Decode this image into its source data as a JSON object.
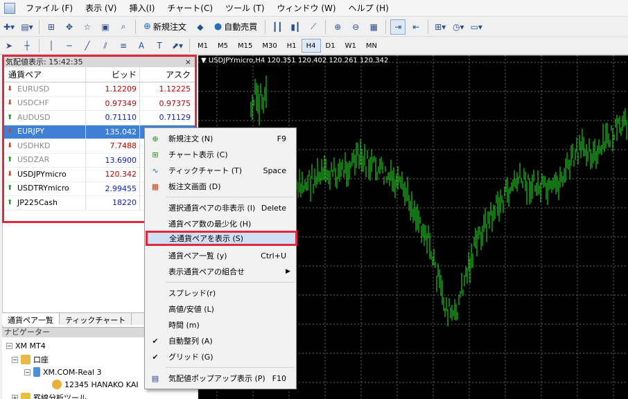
{
  "menubar": {
    "items": [
      "ファイル (F)",
      "表示 (V)",
      "挿入(I)",
      "チャート(C)",
      "ツール (T)",
      "ウィンドウ (W)",
      "ヘルプ (H)"
    ]
  },
  "toolbar": {
    "new_order_label": "新規注文",
    "auto_trade_label": "自動売買",
    "timeframes": [
      "M1",
      "M5",
      "M15",
      "M30",
      "H1",
      "H4",
      "D1",
      "W1",
      "MN"
    ],
    "active_timeframe": "H4"
  },
  "market_watch": {
    "title": "気配値表示: 15:42:35",
    "close_glyph": "×",
    "columns": {
      "symbol": "通貨ペア",
      "bid": "ビッド",
      "ask": "アスク"
    },
    "rows": [
      {
        "symbol": "EURUSD",
        "bid": "1.12209",
        "ask": "1.12225",
        "direction": "down"
      },
      {
        "symbol": "USDCHF",
        "bid": "0.97349",
        "ask": "0.97375",
        "direction": "down"
      },
      {
        "symbol": "AUDUSD",
        "bid": "0.71110",
        "ask": "0.71129",
        "direction": "up"
      },
      {
        "symbol": "EURJPY",
        "bid": "135.042",
        "ask": "",
        "direction": "down"
      },
      {
        "symbol": "USDHKD",
        "bid": "7.7488",
        "ask": "",
        "direction": "down"
      },
      {
        "symbol": "USDZAR",
        "bid": "13.6900",
        "ask": "",
        "direction": "up"
      },
      {
        "symbol": "USDJPYmicro",
        "bid": "120.342",
        "ask": "",
        "direction": "down"
      },
      {
        "symbol": "USDTRYmicro",
        "bid": "2.99455",
        "ask": "",
        "direction": "up"
      },
      {
        "symbol": "JP225Cash",
        "bid": "18220",
        "ask": "",
        "direction": "up"
      }
    ],
    "tabs": [
      "通貨ペア一覧",
      "ティックチャート"
    ]
  },
  "navigator": {
    "title": "ナビゲーター",
    "root": "XM MT4",
    "account_folder": "口座",
    "server": "XM.COM-Real 3",
    "account": "12345 HANAKO KAI",
    "indicators": "罫線分析ツール"
  },
  "chart": {
    "info": "USDJPYmicro,H4  120.351 120.402 120.261 120.342"
  },
  "context_menu": {
    "items": [
      {
        "label": "新規注文 (N)",
        "shortcut": "F9"
      },
      {
        "label": "チャート表示 (C)",
        "shortcut": ""
      },
      {
        "label": "ティックチャート (T)",
        "shortcut": "Space"
      },
      {
        "label": "板注文画面 (D)",
        "shortcut": ""
      },
      {
        "label": "選択通貨ペアの非表示 (I)",
        "shortcut": "Delete"
      },
      {
        "label": "通貨ペア数の最少化 (H)",
        "shortcut": ""
      },
      {
        "label": "全通貨ペアを表示 (S)",
        "shortcut": ""
      },
      {
        "label": "通貨ペア一覧 (y)",
        "shortcut": "Ctrl+U"
      },
      {
        "label": "表示通貨ペアの組合せ",
        "shortcut": ""
      },
      {
        "label": "スプレッド(r)",
        "shortcut": ""
      },
      {
        "label": "高値/安値 (L)",
        "shortcut": ""
      },
      {
        "label": "時間 (m)",
        "shortcut": ""
      },
      {
        "label": "自動整列 (A)",
        "shortcut": ""
      },
      {
        "label": "グリッド (G)",
        "shortcut": ""
      },
      {
        "label": "気配値ポップアップ表示 (P)",
        "shortcut": "F10"
      }
    ],
    "check_glyph": "✔",
    "submenu_glyph": "▶"
  }
}
